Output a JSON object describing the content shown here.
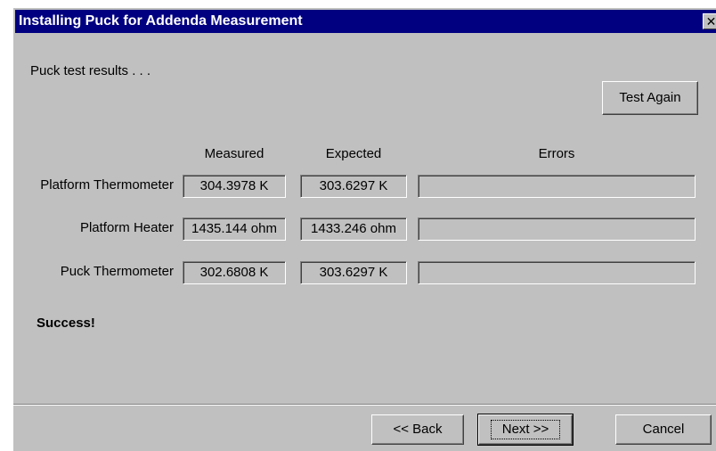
{
  "window": {
    "title": "Installing Puck for Addenda Measurement",
    "close_glyph": "✕"
  },
  "intro": "Puck test results . . .",
  "test_again_label": "Test Again",
  "columns": {
    "measured": "Measured",
    "expected": "Expected",
    "errors": "Errors"
  },
  "rows": [
    {
      "label": "Platform Thermometer",
      "measured": "304.3978 K",
      "expected": "303.6297 K",
      "errors": ""
    },
    {
      "label": "Platform Heater",
      "measured": "1435.144 ohm",
      "expected": "1433.246 ohm",
      "errors": ""
    },
    {
      "label": "Puck Thermometer",
      "measured": "302.6808 K",
      "expected": "303.6297 K",
      "errors": ""
    }
  ],
  "status": "Success!",
  "buttons": {
    "back": "<< Back",
    "next": "Next >>",
    "cancel": "Cancel"
  }
}
